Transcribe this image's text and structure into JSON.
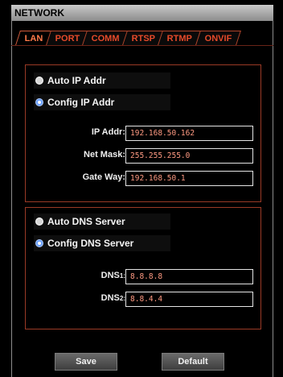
{
  "window": {
    "title": "NETWORK"
  },
  "tabs": [
    {
      "label": "LAN",
      "active": true
    },
    {
      "label": "PORT",
      "active": false
    },
    {
      "label": "COMM",
      "active": false
    },
    {
      "label": "RTSP",
      "active": false
    },
    {
      "label": "RTMP",
      "active": false
    },
    {
      "label": "ONVIF",
      "active": false
    }
  ],
  "ip_section": {
    "auto_label": "Auto IP Addr",
    "config_label": "Config IP Addr",
    "selected": "config",
    "ip_addr": {
      "label": "IP Addr:",
      "value": "192.168.50.162"
    },
    "net_mask": {
      "label": "Net Mask:",
      "value": "255.255.255.0"
    },
    "gate_way": {
      "label": "Gate Way:",
      "value": "192.168.50.1"
    }
  },
  "dns_section": {
    "auto_label": "Auto DNS Server",
    "config_label": "Config DNS Server",
    "selected": "config",
    "dns1": {
      "label_main": "DNS",
      "label_sub": "1:",
      "value": "8.8.8.8"
    },
    "dns2": {
      "label_main": "DNS",
      "label_sub": "2:",
      "value": "8.8.4.4"
    }
  },
  "buttons": {
    "save_label": "Save",
    "default_label": "Default"
  },
  "colors": {
    "accent": "#e64a2a",
    "panel_border": "#9a3a26",
    "input_text": "#ff9a82",
    "radio_selected": "#6aa0ff"
  }
}
